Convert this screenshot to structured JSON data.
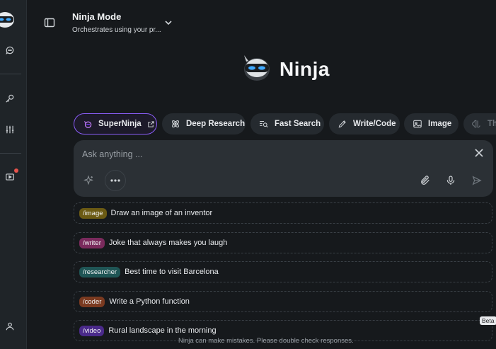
{
  "header": {
    "mode_title": "Ninja Mode",
    "mode_subtitle": "Orchestrates using your pr..."
  },
  "brand": {
    "name": "Ninja"
  },
  "modes": [
    {
      "label": "SuperNinja",
      "icon": "superninja-icon"
    },
    {
      "label": "Deep Research",
      "icon": "atom-icon"
    },
    {
      "label": "Fast Search",
      "icon": "fast-search-icon"
    },
    {
      "label": "Write/Code",
      "icon": "pencil-icon"
    },
    {
      "label": "Image",
      "icon": "image-icon"
    },
    {
      "label": "Th",
      "icon": "brain-icon"
    }
  ],
  "composer": {
    "placeholder": "Ask anything ..."
  },
  "suggestions": [
    {
      "tag": "/image",
      "text": "Draw an image of an inventor",
      "tag_color": "#6b5a13"
    },
    {
      "tag": "/writer",
      "text": "Joke that always makes you laugh",
      "tag_color": "#7a2a5c"
    },
    {
      "tag": "/researcher",
      "text": "Best time to visit Barcelona",
      "tag_color": "#1f5555"
    },
    {
      "tag": "/coder",
      "text": "Write a Python function",
      "tag_color": "#7a3a20"
    },
    {
      "tag": "/video",
      "text": "Rural landscape in the morning",
      "tag_color": "#4a2a8a"
    }
  ],
  "badges": {
    "beta": "Beta"
  },
  "footer": {
    "disclaimer": "Ninja can make mistakes. Please double check responses."
  },
  "colors": {
    "accent": "#8a5cf6",
    "background": "#16191c",
    "rail": "#1f2428"
  }
}
